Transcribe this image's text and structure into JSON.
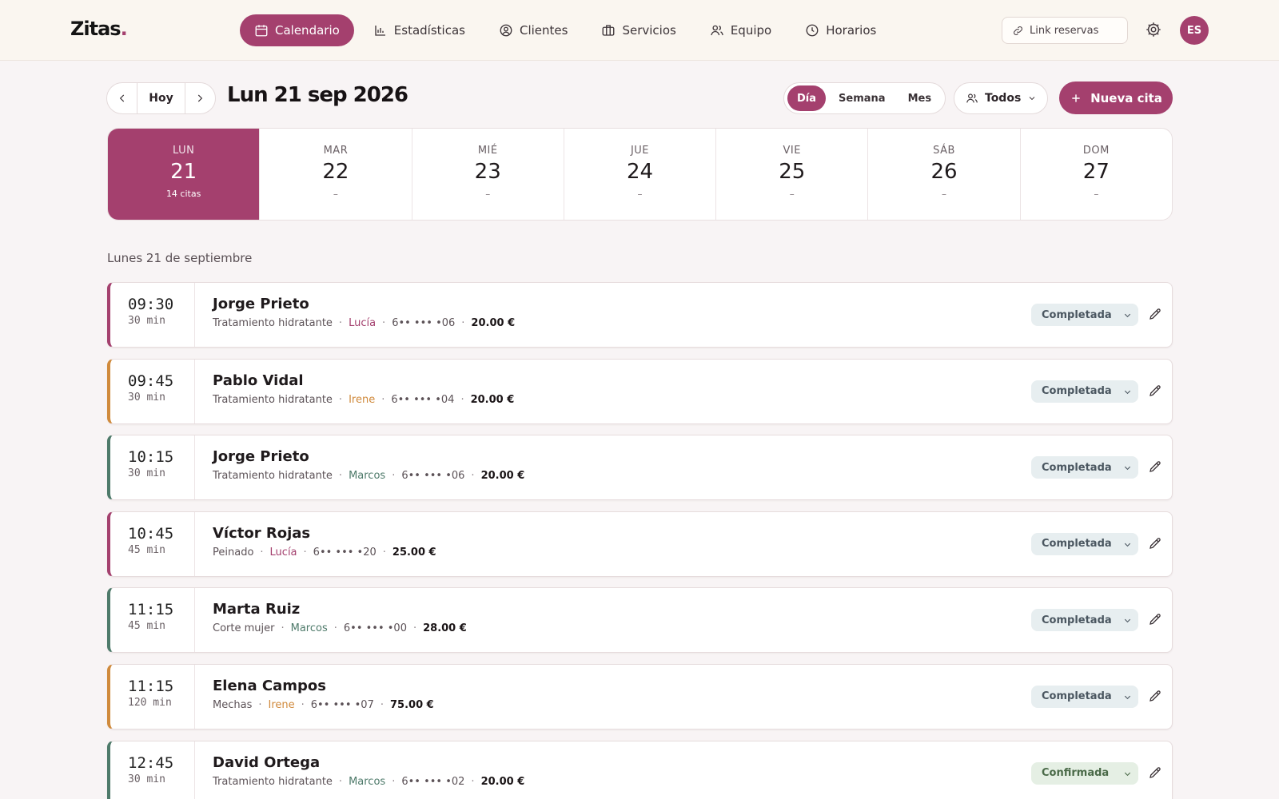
{
  "app": {
    "logo_text": "Zitas",
    "logo_dot": "."
  },
  "nav": [
    {
      "label": "Calendario",
      "icon": "calendar-icon",
      "active": true
    },
    {
      "label": "Estadísticas",
      "icon": "bar-chart-icon",
      "active": false
    },
    {
      "label": "Clientes",
      "icon": "user-circle-icon",
      "active": false
    },
    {
      "label": "Servicios",
      "icon": "briefcase-icon",
      "active": false
    },
    {
      "label": "Equipo",
      "icon": "users-icon",
      "active": false
    },
    {
      "label": "Horarios",
      "icon": "clock-icon",
      "active": false
    }
  ],
  "header": {
    "link_label": "Link reservas",
    "avatar_initials": "ES"
  },
  "toolbar": {
    "today_label": "Hoy",
    "date_title": "Lun 21 sep 2026",
    "views": [
      {
        "label": "Día",
        "active": true
      },
      {
        "label": "Semana",
        "active": false
      },
      {
        "label": "Mes",
        "active": false
      }
    ],
    "filter_label": "Todos",
    "new_label": "Nueva cita"
  },
  "week": [
    {
      "name": "LUN",
      "num": "21",
      "count": "14 citas",
      "active": true
    },
    {
      "name": "MAR",
      "num": "22",
      "count": "–",
      "active": false
    },
    {
      "name": "MIÉ",
      "num": "23",
      "count": "–",
      "active": false
    },
    {
      "name": "JUE",
      "num": "24",
      "count": "–",
      "active": false
    },
    {
      "name": "VIE",
      "num": "25",
      "count": "–",
      "active": false
    },
    {
      "name": "SÁB",
      "num": "26",
      "count": "–",
      "active": false
    },
    {
      "name": "DOM",
      "num": "27",
      "count": "–",
      "active": false
    }
  ],
  "day_label": "Lunes 21 de septiembre",
  "colors": {
    "accent": "#a4406e",
    "lucia": "#a4406e",
    "irene": "#d08a3c",
    "marcos": "#4e7a6a"
  },
  "appointments": [
    {
      "time": "09:30",
      "duration": "30 min",
      "client": "Jorge Prieto",
      "service": "Tratamiento hidratante",
      "staff": "Lucía",
      "phone": "6•• ••• •06",
      "price": "20.00 €",
      "status": "Completada"
    },
    {
      "time": "09:45",
      "duration": "30 min",
      "client": "Pablo Vidal",
      "service": "Tratamiento hidratante",
      "staff": "Irene",
      "phone": "6•• ••• •04",
      "price": "20.00 €",
      "status": "Completada"
    },
    {
      "time": "10:15",
      "duration": "30 min",
      "client": "Jorge Prieto",
      "service": "Tratamiento hidratante",
      "staff": "Marcos",
      "phone": "6•• ••• •06",
      "price": "20.00 €",
      "status": "Completada"
    },
    {
      "time": "10:45",
      "duration": "45 min",
      "client": "Víctor Rojas",
      "service": "Peinado",
      "staff": "Lucía",
      "phone": "6•• ••• •20",
      "price": "25.00 €",
      "status": "Completada"
    },
    {
      "time": "11:15",
      "duration": "45 min",
      "client": "Marta Ruiz",
      "service": "Corte mujer",
      "staff": "Marcos",
      "phone": "6•• ••• •00",
      "price": "28.00 €",
      "status": "Completada"
    },
    {
      "time": "11:15",
      "duration": "120 min",
      "client": "Elena Campos",
      "service": "Mechas",
      "staff": "Irene",
      "phone": "6•• ••• •07",
      "price": "75.00 €",
      "status": "Completada"
    },
    {
      "time": "12:45",
      "duration": "30 min",
      "client": "David Ortega",
      "service": "Tratamiento hidratante",
      "staff": "Marcos",
      "phone": "6•• ••• •02",
      "price": "20.00 €",
      "status": "Confirmada"
    }
  ]
}
